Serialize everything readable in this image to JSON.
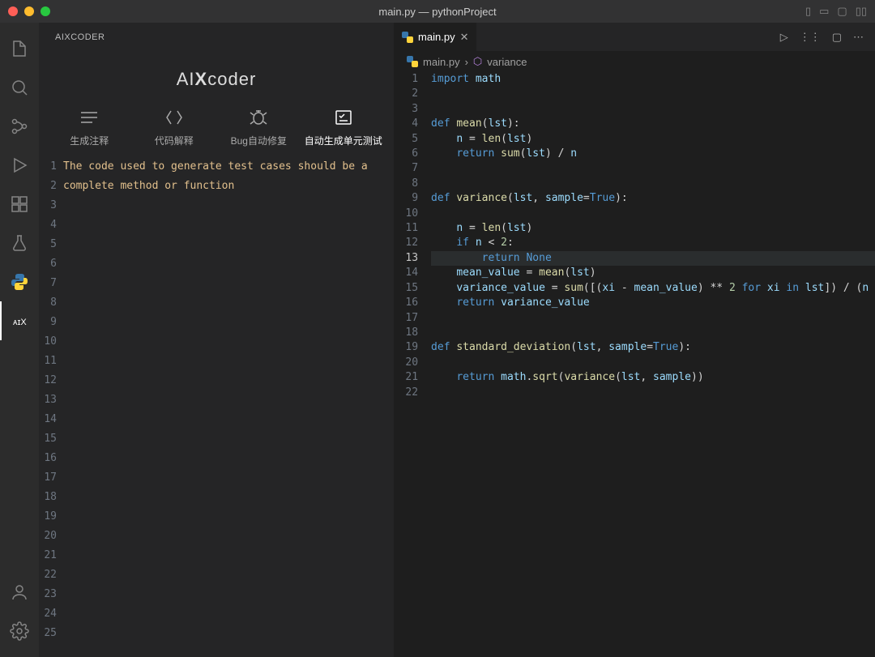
{
  "title": "main.py — pythonProject",
  "traffic_light_colors": {
    "close": "#ff5f57",
    "min": "#febc2e",
    "max": "#28c840"
  },
  "activity": {
    "items": [
      {
        "name": "explorer-icon"
      },
      {
        "name": "search-icon"
      },
      {
        "name": "scm-icon"
      },
      {
        "name": "run-icon"
      },
      {
        "name": "extensions-icon"
      },
      {
        "name": "beaker-icon"
      },
      {
        "name": "python-icon"
      },
      {
        "name": "aixcoder-icon",
        "active": true
      }
    ],
    "bottom": [
      {
        "name": "account-icon"
      },
      {
        "name": "settings-icon"
      }
    ]
  },
  "sidebar": {
    "header": "AIXCODER",
    "logo_left": "AI",
    "logo_x": "X",
    "logo_right": "coder",
    "tabs": [
      {
        "icon": "comment-icon",
        "label": "生成注释"
      },
      {
        "icon": "explain-icon",
        "label": "代码解释"
      },
      {
        "icon": "bug-icon",
        "label": "Bug自动修复"
      },
      {
        "icon": "test-icon",
        "label": "自动生成单元测试",
        "active": true
      }
    ],
    "hint": "The code used to generate test cases should be a complete method or function",
    "line_count": 25
  },
  "editor": {
    "tab_label": "main.py",
    "breadcrumbs": {
      "file": "main.py",
      "sep": "›",
      "symbol": "variance"
    },
    "current_line": 13,
    "actions": [
      {
        "name": "run-action-icon"
      },
      {
        "name": "split-action-icon"
      },
      {
        "name": "more-action-icon"
      }
    ],
    "code": [
      {
        "n": 1,
        "t": [
          [
            "kw",
            "import"
          ],
          [
            "p",
            " "
          ],
          [
            "var",
            "math"
          ]
        ]
      },
      {
        "n": 2,
        "t": []
      },
      {
        "n": 3,
        "t": []
      },
      {
        "n": 4,
        "t": [
          [
            "kw",
            "def"
          ],
          [
            "p",
            " "
          ],
          [
            "fn",
            "mean"
          ],
          [
            "p",
            "("
          ],
          [
            "var",
            "lst"
          ],
          [
            "p",
            "):"
          ]
        ]
      },
      {
        "n": 5,
        "t": [
          [
            "p",
            "    "
          ],
          [
            "var",
            "n"
          ],
          [
            "p",
            " "
          ],
          [
            "op",
            "="
          ],
          [
            "p",
            " "
          ],
          [
            "fn",
            "len"
          ],
          [
            "p",
            "("
          ],
          [
            "var",
            "lst"
          ],
          [
            "p",
            ")"
          ]
        ]
      },
      {
        "n": 6,
        "t": [
          [
            "p",
            "    "
          ],
          [
            "kw",
            "return"
          ],
          [
            "p",
            " "
          ],
          [
            "fn",
            "sum"
          ],
          [
            "p",
            "("
          ],
          [
            "var",
            "lst"
          ],
          [
            "p",
            ") "
          ],
          [
            "op",
            "/"
          ],
          [
            "p",
            " "
          ],
          [
            "var",
            "n"
          ]
        ]
      },
      {
        "n": 7,
        "t": []
      },
      {
        "n": 8,
        "t": []
      },
      {
        "n": 9,
        "t": [
          [
            "kw",
            "def"
          ],
          [
            "p",
            " "
          ],
          [
            "fn",
            "variance"
          ],
          [
            "p",
            "("
          ],
          [
            "var",
            "lst"
          ],
          [
            "p",
            ", "
          ],
          [
            "var",
            "sample"
          ],
          [
            "op",
            "="
          ],
          [
            "con",
            "True"
          ],
          [
            "p",
            "):"
          ]
        ]
      },
      {
        "n": 10,
        "t": []
      },
      {
        "n": 11,
        "t": [
          [
            "p",
            "    "
          ],
          [
            "var",
            "n"
          ],
          [
            "p",
            " "
          ],
          [
            "op",
            "="
          ],
          [
            "p",
            " "
          ],
          [
            "fn",
            "len"
          ],
          [
            "p",
            "("
          ],
          [
            "var",
            "lst"
          ],
          [
            "p",
            ")"
          ]
        ]
      },
      {
        "n": 12,
        "t": [
          [
            "p",
            "    "
          ],
          [
            "kw",
            "if"
          ],
          [
            "p",
            " "
          ],
          [
            "var",
            "n"
          ],
          [
            "p",
            " "
          ],
          [
            "op",
            "<"
          ],
          [
            "p",
            " "
          ],
          [
            "num",
            "2"
          ],
          [
            "p",
            ":"
          ]
        ]
      },
      {
        "n": 13,
        "t": [
          [
            "p",
            "        "
          ],
          [
            "kw",
            "return"
          ],
          [
            "p",
            " "
          ],
          [
            "con",
            "None"
          ]
        ]
      },
      {
        "n": 14,
        "t": [
          [
            "p",
            "    "
          ],
          [
            "var",
            "mean_value"
          ],
          [
            "p",
            " "
          ],
          [
            "op",
            "="
          ],
          [
            "p",
            " "
          ],
          [
            "fn",
            "mean"
          ],
          [
            "p",
            "("
          ],
          [
            "var",
            "lst"
          ],
          [
            "p",
            ")"
          ]
        ]
      },
      {
        "n": 15,
        "t": [
          [
            "p",
            "    "
          ],
          [
            "var",
            "variance_value"
          ],
          [
            "p",
            " "
          ],
          [
            "op",
            "="
          ],
          [
            "p",
            " "
          ],
          [
            "fn",
            "sum"
          ],
          [
            "p",
            "([("
          ],
          [
            "var",
            "xi"
          ],
          [
            "p",
            " "
          ],
          [
            "op",
            "-"
          ],
          [
            "p",
            " "
          ],
          [
            "var",
            "mean_value"
          ],
          [
            "p",
            ") "
          ],
          [
            "op",
            "**"
          ],
          [
            "p",
            " "
          ],
          [
            "num",
            "2"
          ],
          [
            "p",
            " "
          ],
          [
            "kw",
            "for"
          ],
          [
            "p",
            " "
          ],
          [
            "var",
            "xi"
          ],
          [
            "p",
            " "
          ],
          [
            "kw",
            "in"
          ],
          [
            "p",
            " "
          ],
          [
            "var",
            "lst"
          ],
          [
            "p",
            "]) "
          ],
          [
            "op",
            "/"
          ],
          [
            "p",
            " ("
          ],
          [
            "var",
            "n"
          ],
          [
            "p",
            " "
          ]
        ]
      },
      {
        "n": 16,
        "t": [
          [
            "p",
            "    "
          ],
          [
            "kw",
            "return"
          ],
          [
            "p",
            " "
          ],
          [
            "var",
            "variance_value"
          ]
        ]
      },
      {
        "n": 17,
        "t": []
      },
      {
        "n": 18,
        "t": []
      },
      {
        "n": 19,
        "t": [
          [
            "kw",
            "def"
          ],
          [
            "p",
            " "
          ],
          [
            "fn",
            "standard_deviation"
          ],
          [
            "p",
            "("
          ],
          [
            "var",
            "lst"
          ],
          [
            "p",
            ", "
          ],
          [
            "var",
            "sample"
          ],
          [
            "op",
            "="
          ],
          [
            "con",
            "True"
          ],
          [
            "p",
            "):"
          ]
        ]
      },
      {
        "n": 20,
        "t": []
      },
      {
        "n": 21,
        "t": [
          [
            "p",
            "    "
          ],
          [
            "kw",
            "return"
          ],
          [
            "p",
            " "
          ],
          [
            "var",
            "math"
          ],
          [
            "p",
            "."
          ],
          [
            "fn",
            "sqrt"
          ],
          [
            "p",
            "("
          ],
          [
            "fn",
            "variance"
          ],
          [
            "p",
            "("
          ],
          [
            "var",
            "lst"
          ],
          [
            "p",
            ", "
          ],
          [
            "var",
            "sample"
          ],
          [
            "p",
            "))"
          ]
        ]
      },
      {
        "n": 22,
        "t": []
      }
    ]
  }
}
